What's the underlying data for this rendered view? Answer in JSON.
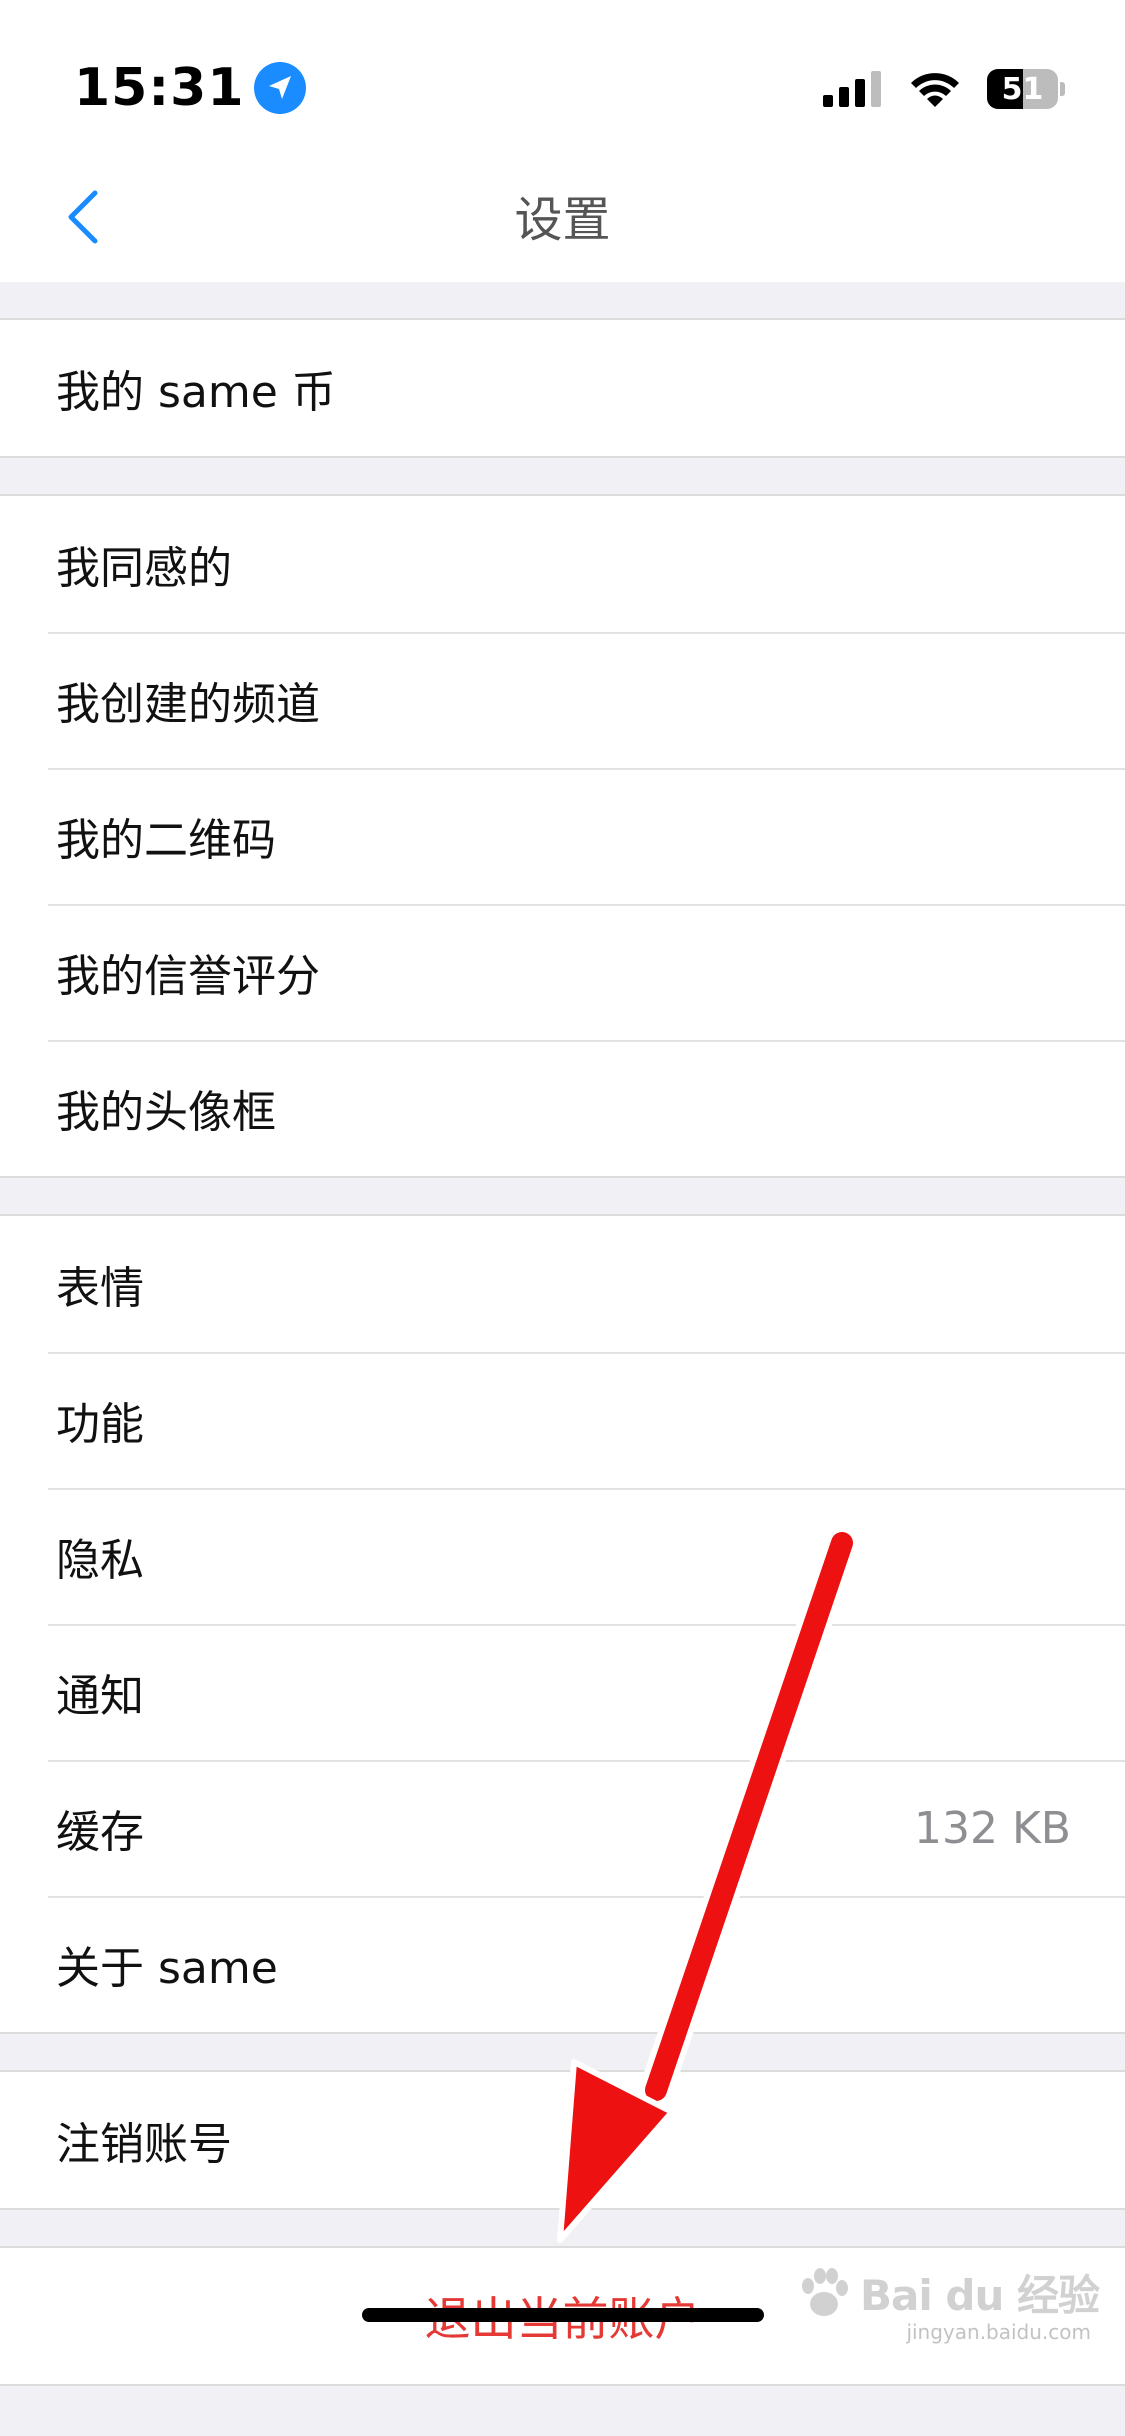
{
  "status_bar": {
    "time": "15:31",
    "battery_level": "51",
    "battery_fraction": 0.51
  },
  "nav": {
    "title": "设置"
  },
  "groups": {
    "coins": {
      "items": [
        {
          "label": "我的 same 币"
        }
      ]
    },
    "personal": {
      "items": [
        {
          "label": "我同感的"
        },
        {
          "label": "我创建的频道"
        },
        {
          "label": "我的二维码"
        },
        {
          "label": "我的信誉评分"
        },
        {
          "label": "我的头像框"
        }
      ]
    },
    "general": {
      "items": [
        {
          "label": "表情"
        },
        {
          "label": "功能"
        },
        {
          "label": "隐私"
        },
        {
          "label": "通知"
        },
        {
          "label": "缓存",
          "value": "132 KB"
        },
        {
          "label": "关于 same"
        }
      ]
    },
    "account": {
      "items": [
        {
          "label": "注销账号"
        }
      ]
    },
    "logout": {
      "label": "退出当前账户"
    }
  },
  "watermark": {
    "brand": "Bai du 经验",
    "sub": "jingyan.baidu.com"
  },
  "colors": {
    "accent_blue": "#1a8cff",
    "logout_red": "#e53935",
    "annotation_arrow": "#ee1111",
    "background": "#f0f0f5"
  }
}
